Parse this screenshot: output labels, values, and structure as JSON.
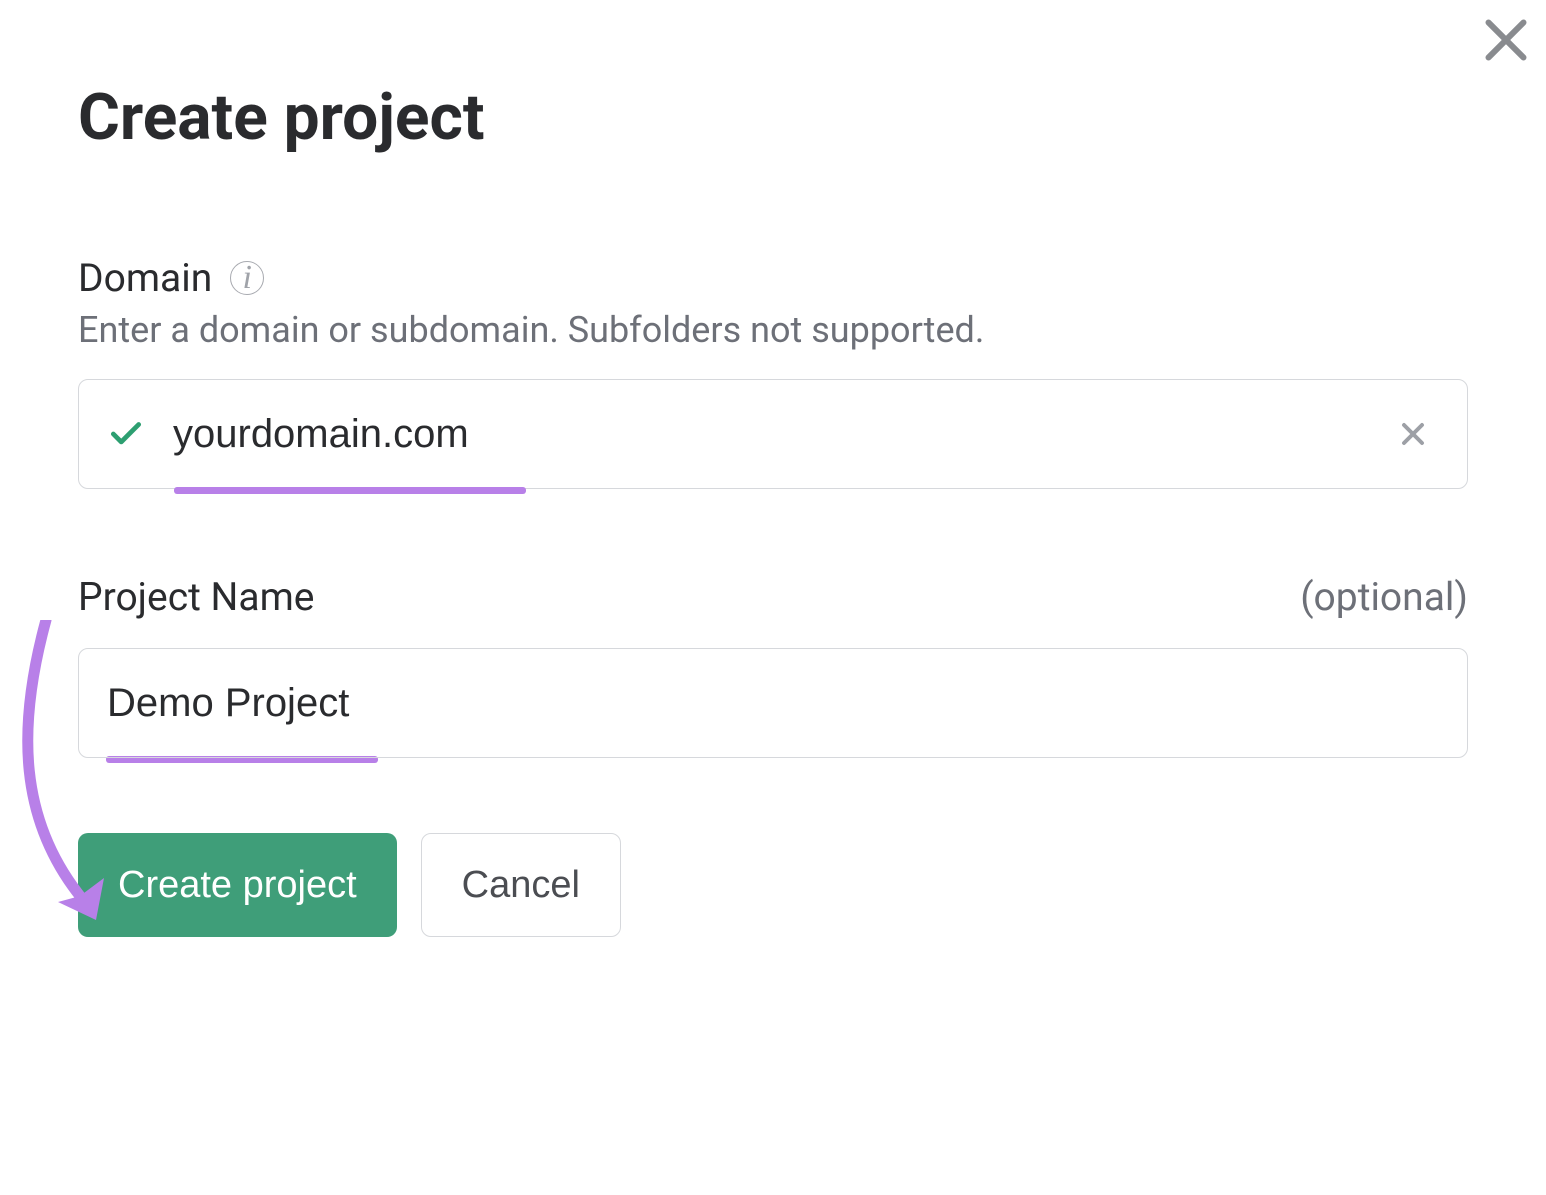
{
  "dialog": {
    "title": "Create project",
    "domain_section": {
      "label": "Domain",
      "helper": "Enter a domain or subdomain. Subfolders not supported.",
      "value": "yourdomain.com"
    },
    "name_section": {
      "label": "Project Name",
      "optional": "(optional)",
      "value": "Demo Project"
    },
    "buttons": {
      "primary": "Create project",
      "secondary": "Cancel"
    }
  },
  "colors": {
    "accent": "#3f9e79",
    "highlight": "#b880e8"
  }
}
